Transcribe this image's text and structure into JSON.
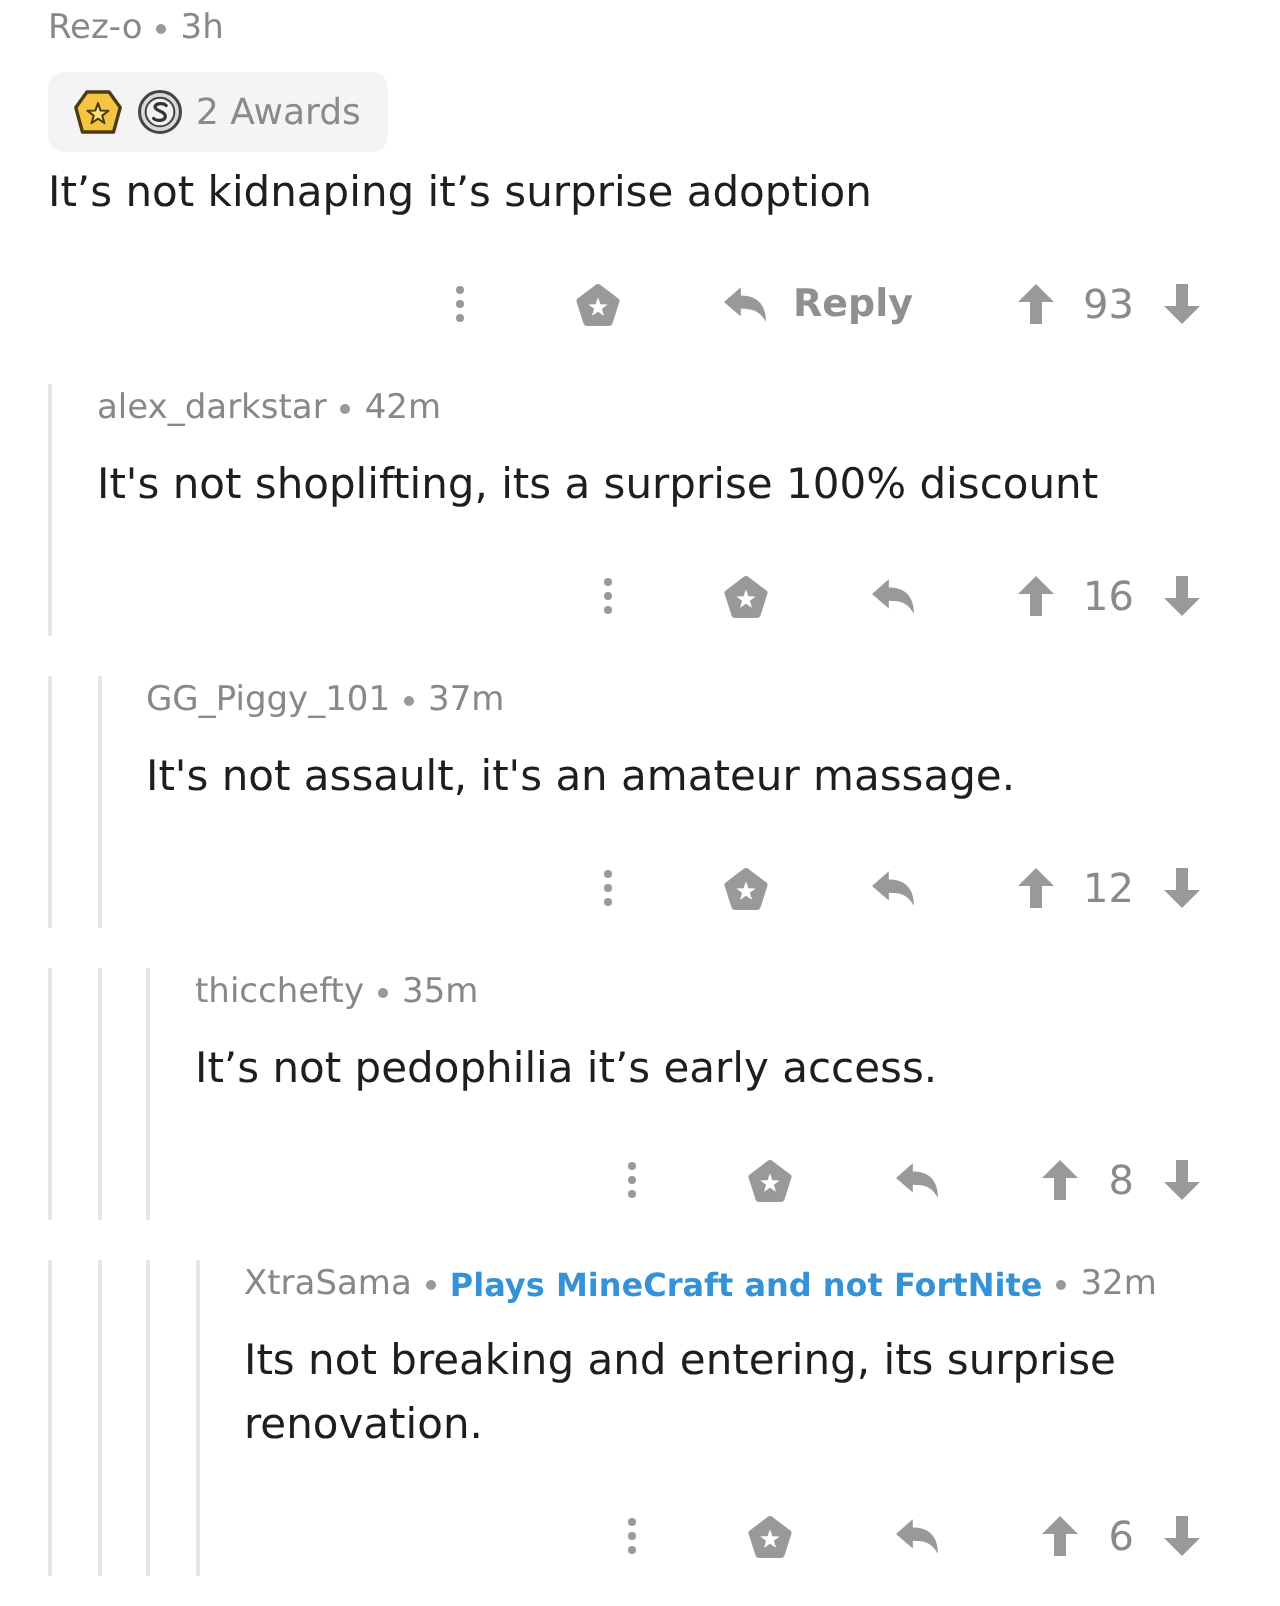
{
  "comments": [
    {
      "author": "Rez-o",
      "time": "3h",
      "awards": {
        "icons": [
          {
            "kind": "star"
          },
          {
            "kind": "coin"
          }
        ],
        "label": "2 Awards"
      },
      "body": "It’s not kidnaping it’s surprise adoption",
      "reply_label": "Reply",
      "score": "93",
      "children": [
        {
          "author": "alex_darkstar",
          "time": "42m",
          "body": "It's not shoplifting, its a surprise 100% discount",
          "score": "16",
          "children": [
            {
              "author": "GG_Piggy_101",
              "time": "37m",
              "body": "It's not assault, it's an amateur massage.",
              "score": "12",
              "children": [
                {
                  "author": "thicchefty",
                  "time": "35m",
                  "body": "It’s not pedophilia it’s early access.",
                  "score": "8",
                  "children": [
                    {
                      "author": "XtraSama",
                      "flair": "Plays MineCraft and not FortNite",
                      "time": "32m",
                      "body": "Its not breaking and entering, its surprise renovation.",
                      "score": "6"
                    }
                  ]
                }
              ]
            }
          ]
        }
      ]
    }
  ]
}
